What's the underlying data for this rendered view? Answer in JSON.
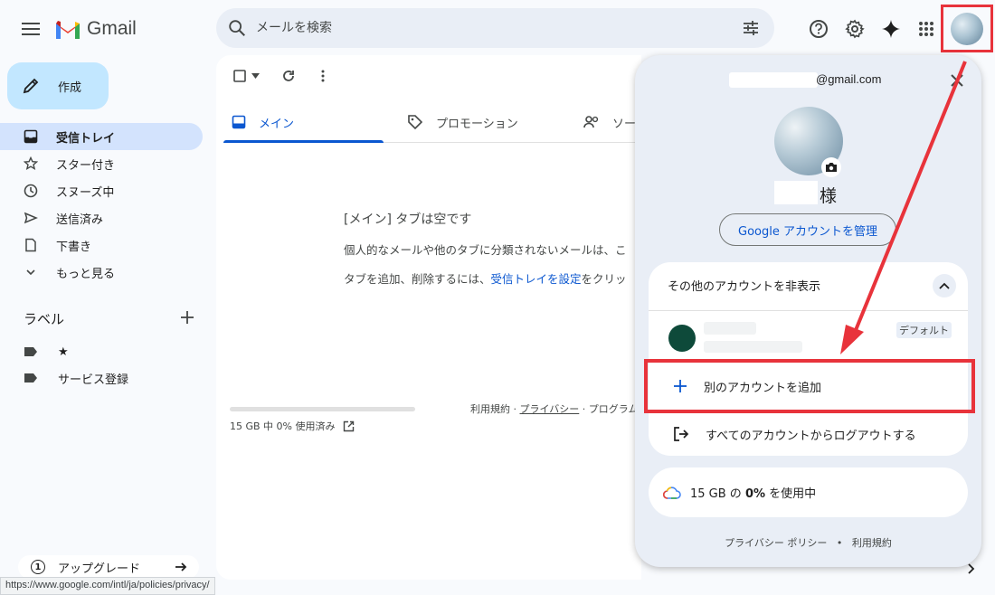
{
  "app": {
    "name": "Gmail"
  },
  "search": {
    "placeholder": "メールを検索"
  },
  "compose": {
    "label": "作成"
  },
  "nav": {
    "items": [
      {
        "label": "受信トレイ",
        "icon": "inbox-icon",
        "active": true
      },
      {
        "label": "スター付き",
        "icon": "star-icon"
      },
      {
        "label": "スヌーズ中",
        "icon": "clock-icon"
      },
      {
        "label": "送信済み",
        "icon": "send-icon"
      },
      {
        "label": "下書き",
        "icon": "draft-icon"
      },
      {
        "label": "もっと見る",
        "icon": "chevron-down-icon"
      }
    ]
  },
  "labels": {
    "title": "ラベル",
    "items": [
      {
        "label": "★",
        "icon": "label-icon"
      },
      {
        "label": "サービス登録",
        "icon": "label-icon"
      }
    ]
  },
  "upgrade": {
    "label": "アップグレード",
    "badge": "1"
  },
  "status_bar": {
    "url": "https://www.google.com/intl/ja/policies/privacy/"
  },
  "tabs": [
    {
      "label": "メイン",
      "active": true
    },
    {
      "label": "プロモーション"
    },
    {
      "label": "ソー"
    }
  ],
  "empty": {
    "title": "[メイン] タブは空です",
    "line1": "個人的なメールや他のタブに分類されないメールは、こ",
    "line2_prefix": "タブを追加、削除するには、",
    "line2_link": "受信トレイを設定",
    "line2_suffix": "をクリッ"
  },
  "storage": {
    "text": "15 GB 中 0% 使用済み",
    "percent": 0
  },
  "footer": {
    "terms": "利用規約",
    "privacy": "プライバシー",
    "program": "プログラム"
  },
  "account_popup": {
    "email_suffix": "@gmail.com",
    "name_suffix": "様",
    "manage_button": "Google アカウントを管理",
    "hide_accounts": "その他のアカウントを非表示",
    "default_badge": "デフォルト",
    "add_account": "別のアカウントを追加",
    "logout_all": "すべてのアカウントからログアウトする",
    "storage_prefix": "15 GB の ",
    "storage_percent": "0%",
    "storage_suffix": " を使用中",
    "footer_privacy": "プライバシー ポリシー",
    "footer_dot": "•",
    "footer_terms": "利用規約"
  },
  "colors": {
    "accent": "#0b57d0",
    "compose_bg": "#c2e7ff",
    "active_nav": "#d3e3fd",
    "highlight": "#e8333b",
    "account_avatar": "#0e4a3a"
  }
}
